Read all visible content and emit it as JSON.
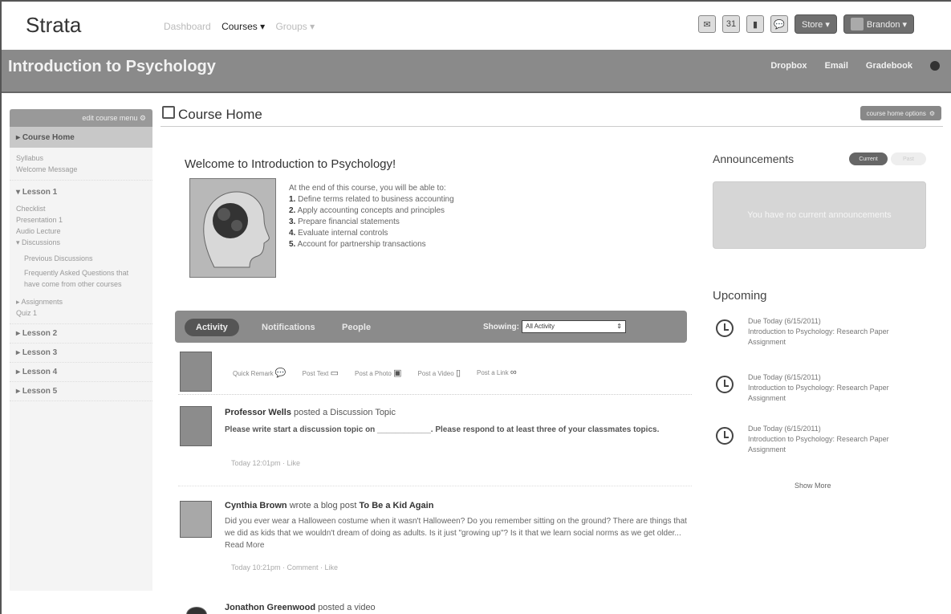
{
  "topbar": {
    "brand": "Strata",
    "nav": [
      "Dashboard",
      "Courses ▾",
      "Groups ▾"
    ],
    "icons": [
      "messages-icon",
      "calendar-icon",
      "library-icon",
      "chat-icon"
    ],
    "store_label": "Store ▾",
    "user_label": "Brandon ▾"
  },
  "course": {
    "title": "Introduction to Psychology",
    "links": [
      "Dropbox",
      "Email",
      "Gradebook"
    ]
  },
  "sidebar": {
    "edit_label": "edit course menu",
    "selected": "Course Home",
    "home_items": [
      "Syllabus",
      "Welcome Message"
    ],
    "lesson1": {
      "title": "Lesson 1",
      "items": [
        "Checklist",
        "Presentation 1",
        "Audio Lecture",
        "Discussions"
      ],
      "discussion_items": [
        "Previous Discussions",
        "Frequently Asked Questions that have come from other courses"
      ],
      "more_items": [
        "Assignments",
        "Quiz 1"
      ]
    },
    "lessons": [
      "Lesson 2",
      "Lesson 3",
      "Lesson 4",
      "Lesson 5"
    ]
  },
  "main": {
    "title": "Course Home",
    "options_label": "course home options",
    "welcome": "Welcome to Introduction to Psychology!",
    "intro": "At the end of this course, you will be able to:",
    "objectives": [
      {
        "n": "1.",
        "t": "Define terms related to business accounting"
      },
      {
        "n": "2.",
        "t": "Apply accounting concepts and principles"
      },
      {
        "n": "3.",
        "t": "Prepare financial statements"
      },
      {
        "n": "4.",
        "t": "Evaluate internal controls"
      },
      {
        "n": "5.",
        "t": "Account for partnership transactions"
      }
    ]
  },
  "activity": {
    "tabs": [
      "Activity",
      "Notifications",
      "People"
    ],
    "showing_label": "Showing:",
    "showing_value": "All Activity",
    "post_actions": [
      "Quick Remark",
      "Post Text",
      "Post a Photo",
      "Post a Video",
      "Post a Link"
    ]
  },
  "feed": [
    {
      "author": "Professor Wells",
      "action": "posted a Discussion Topic",
      "link": "",
      "body": "Please write start a discussion topic on ____________. Please respond to at least three of your classmates topics.",
      "meta": "Today 12:01pm · Like"
    },
    {
      "author": "Cynthia Brown",
      "action": "wrote a blog post",
      "link": "To Be a Kid Again",
      "body": "Did you ever wear a Halloween costume when it wasn't Halloween? Do you remember sitting on the ground? There are things that we did as kids that we wouldn't dream of doing as adults. Is it just \"growing up\"? Is it that we learn social norms as we get older... Read More",
      "meta": "Today 10:21pm · Comment · Like"
    },
    {
      "author": "Jonathon Greenwood",
      "action": "posted a video",
      "link": "",
      "body": "",
      "meta": ""
    }
  ],
  "announcements": {
    "title": "Announcements",
    "btn1": "Current",
    "btn2": "Past",
    "empty": "You have no current announcements"
  },
  "upcoming": {
    "title": "Upcoming",
    "items": [
      {
        "due": "Due Today",
        "date": "(6/15/2011)",
        "title": "Introduction to Psychology: Research Paper Assignment"
      },
      {
        "due": "Due Today",
        "date": "(6/15/2011)",
        "title": "Introduction to Psychology: Research Paper Assignment"
      },
      {
        "due": "Due Today",
        "date": "(6/15/2011)",
        "title": "Introduction to Psychology: Research Paper Assignment"
      }
    ],
    "show_more": "Show More"
  }
}
